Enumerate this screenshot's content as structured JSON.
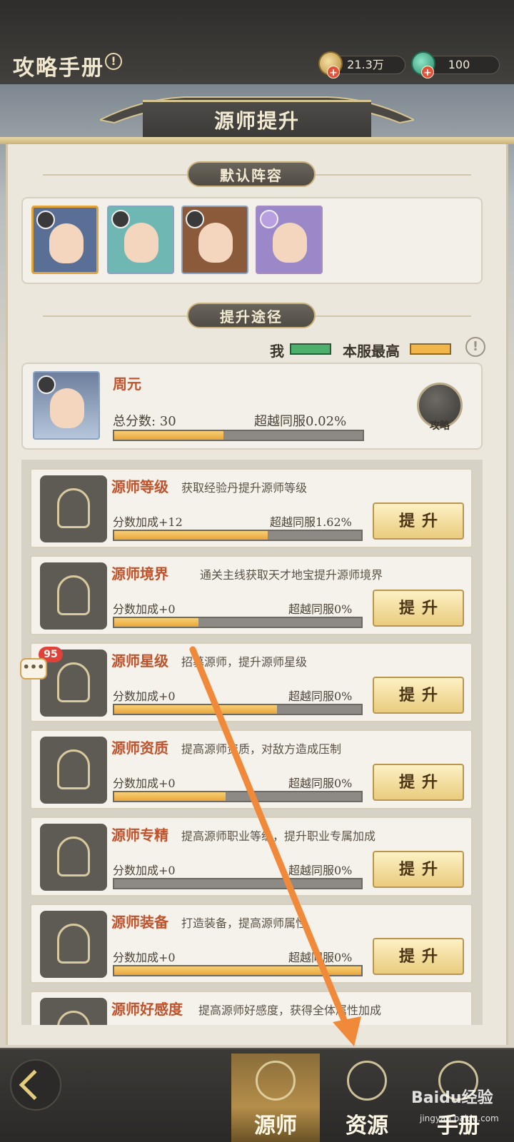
{
  "header": {
    "title": "攻略手册",
    "info_glyph": "!",
    "coins": "21.3万",
    "jade": "100"
  },
  "banner": {
    "title": "源师提升"
  },
  "team": {
    "title": "默认阵容",
    "heroes": [
      {
        "name": "hero-1",
        "border": "#e2a43a",
        "bg": "#5a6f96"
      },
      {
        "name": "hero-2",
        "border": "#8aa3c4",
        "bg": "#6fb7b3"
      },
      {
        "name": "hero-3",
        "border": "#8aa3c4",
        "bg": "#8a5a3a"
      },
      {
        "name": "hero-4",
        "border": "#a88ac4",
        "bg": "#9a88c9"
      }
    ]
  },
  "paths": {
    "title": "提升途径",
    "legend_me": "我",
    "legend_top": "本服最高"
  },
  "player": {
    "name": "周元",
    "score": "总分数: 30",
    "beyond": "超越同服0.02%",
    "progress": 0.44,
    "strategy_label": "攻略"
  },
  "cards": [
    {
      "title": "源师等级",
      "desc": "获取经验丹提升源师等级",
      "bonus": "分数加成+12",
      "beyond": "超越同服1.62%",
      "progress": 0.62,
      "button": "提升"
    },
    {
      "title": "源师境界",
      "desc": "通关主线获取天才地宝提升源师境界",
      "bonus": "分数加成+0",
      "beyond": "超越同服0%",
      "progress": 0.34,
      "button": "提升"
    },
    {
      "title": "源师星级",
      "desc": "招募源师，提升源师星级",
      "bonus": "分数加成+0",
      "beyond": "超越同服0%",
      "progress": 0.66,
      "button": "提升"
    },
    {
      "title": "源师资质",
      "desc": "提高源师资质，对敌方造成压制",
      "bonus": "分数加成+0",
      "beyond": "超越同服0%",
      "progress": 0.45,
      "button": "提升"
    },
    {
      "title": "源师专精",
      "desc": "提高源师职业等级，提升职业专属加成",
      "bonus": "分数加成+0",
      "beyond": "超越同服0%",
      "progress": 0.0,
      "button": "提升"
    },
    {
      "title": "源师装备",
      "desc": "打造装备，提高源师属性",
      "bonus": "分数加成+0",
      "beyond": "超越同服0%",
      "progress": 1.0,
      "button": "提升"
    },
    {
      "title": "源师好感度",
      "desc": "提高源师好感度，获得全体属性加成",
      "bonus": "",
      "beyond": "",
      "progress": 0,
      "button": ""
    }
  ],
  "notification_count": "95",
  "chat_glyph": "•••",
  "nav": {
    "tabs": [
      {
        "label": "源师",
        "active": true
      },
      {
        "label": "资源",
        "active": false
      },
      {
        "label": "手册",
        "active": false
      }
    ]
  },
  "watermark": {
    "brand": "Baidu经验",
    "url": "jingyan.baidu.com"
  },
  "colors": {
    "accent_title": "#c0532c",
    "arrow": "#f08a3a",
    "progress_gold": "#e9a63a",
    "legend_me": "#4cb06c"
  }
}
